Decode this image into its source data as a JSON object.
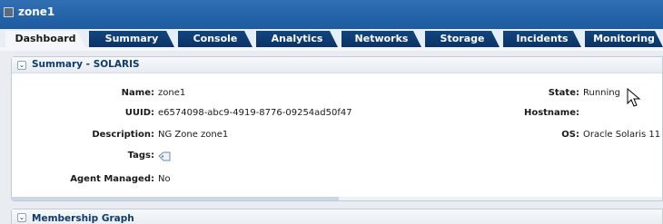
{
  "window": {
    "title": "zone1",
    "icon": "window-icon"
  },
  "tabs": [
    {
      "label": "Dashboard",
      "active": true
    },
    {
      "label": "Summary",
      "active": false
    },
    {
      "label": "Console",
      "active": false
    },
    {
      "label": "Analytics",
      "active": false
    },
    {
      "label": "Networks",
      "active": false
    },
    {
      "label": "Storage",
      "active": false
    },
    {
      "label": "Incidents",
      "active": false
    },
    {
      "label": "Monitoring",
      "active": false
    }
  ],
  "summary_panel": {
    "title": "Summary - SOLARIS",
    "left": [
      {
        "label": "Name:",
        "value": "zone1"
      },
      {
        "label": "UUID:",
        "value": "e6574098-abc9-4919-8776-09254ad50f47"
      },
      {
        "label": "Description:",
        "value": "NG Zone zone1"
      },
      {
        "label": "Tags:",
        "value": ""
      },
      {
        "label": "Agent Managed:",
        "value": "No"
      }
    ],
    "right": [
      {
        "label": "State:",
        "value": "Running"
      },
      {
        "label": "Hostname:",
        "value": ""
      },
      {
        "label": "OS:",
        "value": "Oracle Solaris 11"
      }
    ]
  },
  "membership_panel": {
    "title": "Membership Graph"
  },
  "colors": {
    "titlebar": "#1d5aa0",
    "tab_inactive": "#0a3466",
    "panel_title": "#0f3b6b"
  }
}
